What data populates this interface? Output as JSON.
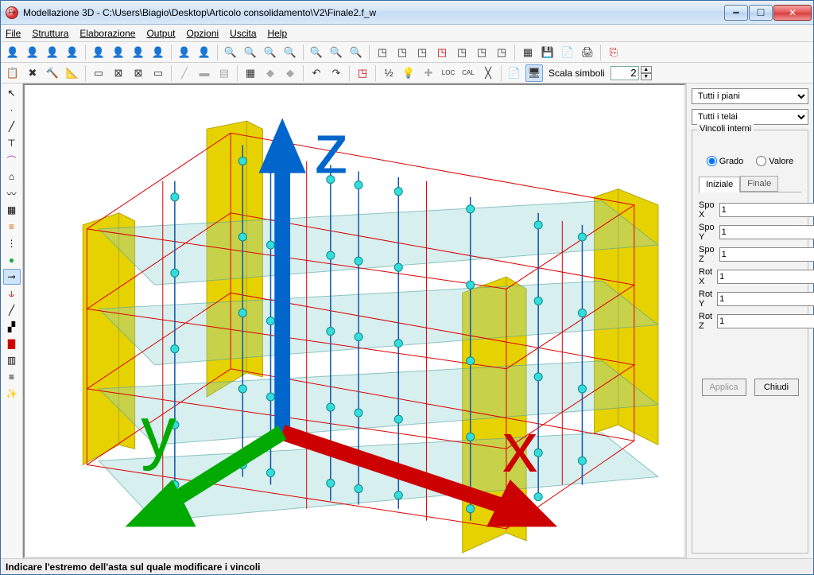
{
  "window": {
    "title": "Modellazione 3D - C:\\Users\\Biagio\\Desktop\\Articolo consolidamento\\V2\\Finale2.f_w"
  },
  "menu": {
    "items": [
      "File",
      "Struttura",
      "Elaborazione",
      "Output",
      "Opzioni",
      "Uscita",
      "Help"
    ]
  },
  "toolbar2": {
    "scala_label": "Scala simboli",
    "scala_value": "2"
  },
  "rightPanel": {
    "select1": "Tutti i piani",
    "select2": "Tutti i telai",
    "group_title": "Vincoli interni",
    "radio1": "Grado",
    "radio2": "Valore",
    "tab_active": "Iniziale",
    "tab_inactive": "Finale",
    "fields": {
      "spoX": {
        "label": "Spo X",
        "value": "1"
      },
      "spoY": {
        "label": "Spo Y",
        "value": "1"
      },
      "spoZ": {
        "label": "Spo Z",
        "value": "1"
      },
      "rotX": {
        "label": "Rot X",
        "value": "1"
      },
      "rotY": {
        "label": "Rot Y",
        "value": "1"
      },
      "rotZ": {
        "label": "Rot Z",
        "value": "1"
      }
    },
    "btn_apply": "Applica",
    "btn_close": "Chiudi"
  },
  "statusbar": {
    "text": "Indicare l'estremo dell'asta sul quale modificare i vincoli"
  },
  "gizmo": {
    "x": "x",
    "y": "y",
    "z": "z"
  }
}
